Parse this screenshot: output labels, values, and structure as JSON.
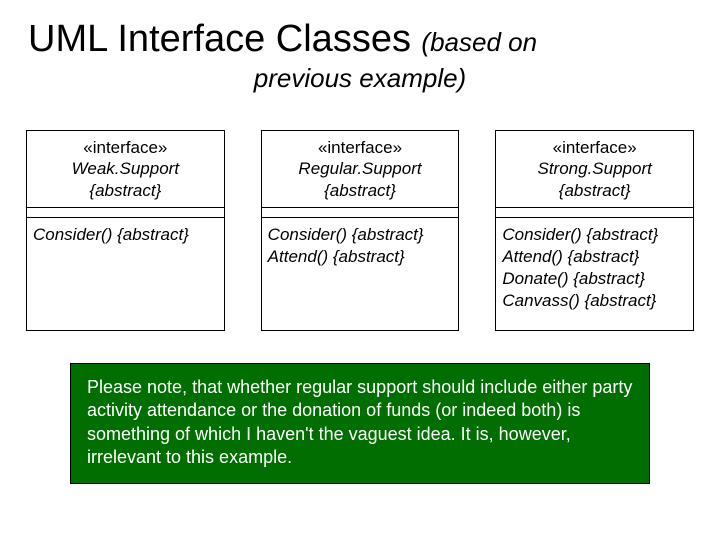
{
  "title": {
    "main": "UML Interface Classes",
    "sub1": "(based on",
    "sub2": "previous example)"
  },
  "boxes": [
    {
      "stereo": "«interface»",
      "name": "Weak.Support",
      "abstract": "{abstract}",
      "ops": [
        "Consider() {abstract}"
      ]
    },
    {
      "stereo": "«interface»",
      "name": "Regular.Support",
      "abstract": "{abstract}",
      "ops": [
        "Consider() {abstract}",
        "Attend() {abstract}"
      ]
    },
    {
      "stereo": "«interface»",
      "name": "Strong.Support",
      "abstract": "{abstract}",
      "ops": [
        "Consider() {abstract}",
        "Attend() {abstract}",
        "Donate() {abstract}",
        "Canvass() {abstract}"
      ]
    }
  ],
  "note": "Please note, that whether regular support should include either party activity attendance or the donation of funds (or indeed both) is something of which I haven't the vaguest idea. It is, however, irrelevant to this example."
}
